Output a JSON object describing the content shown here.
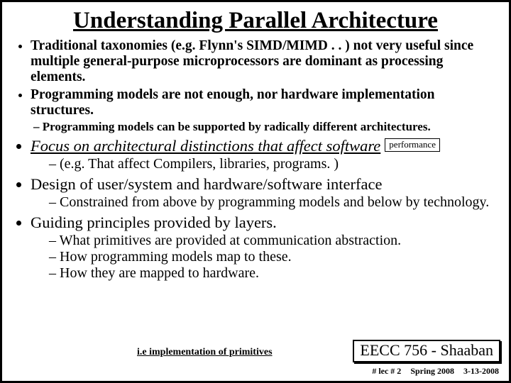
{
  "title": "Understanding Parallel Architecture",
  "b1": "Traditional taxonomies (e.g. Flynn's SIMD/MIMD . . ) not very useful since multiple general-purpose microprocessors are dominant as processing elements.",
  "b2": "Programming models are not enough, nor hardware implementation structures.",
  "b2s1": "Programming models can be supported by radically different architectures.",
  "b3": "Focus on architectural distinctions that affect software",
  "perf": "performance",
  "b3s1": "(e.g.  That affect Compilers, libraries, programs. )",
  "b4": "Design of user/system and hardware/software interface",
  "b4s1": "Constrained from above by programming models and below by technology.",
  "b5": "Guiding principles provided by layers.",
  "b5s1": "What primitives are provided at communication abstraction.",
  "b5s2": "How programming models map to these.",
  "b5s3": "How they are mapped to hardware.",
  "impl": "i.e implementation of primitives",
  "course": "EECC 756 - Shaaban",
  "foot_lec": "#  lec # 2",
  "foot_term": "Spring 2008",
  "foot_date": "3-13-2008"
}
